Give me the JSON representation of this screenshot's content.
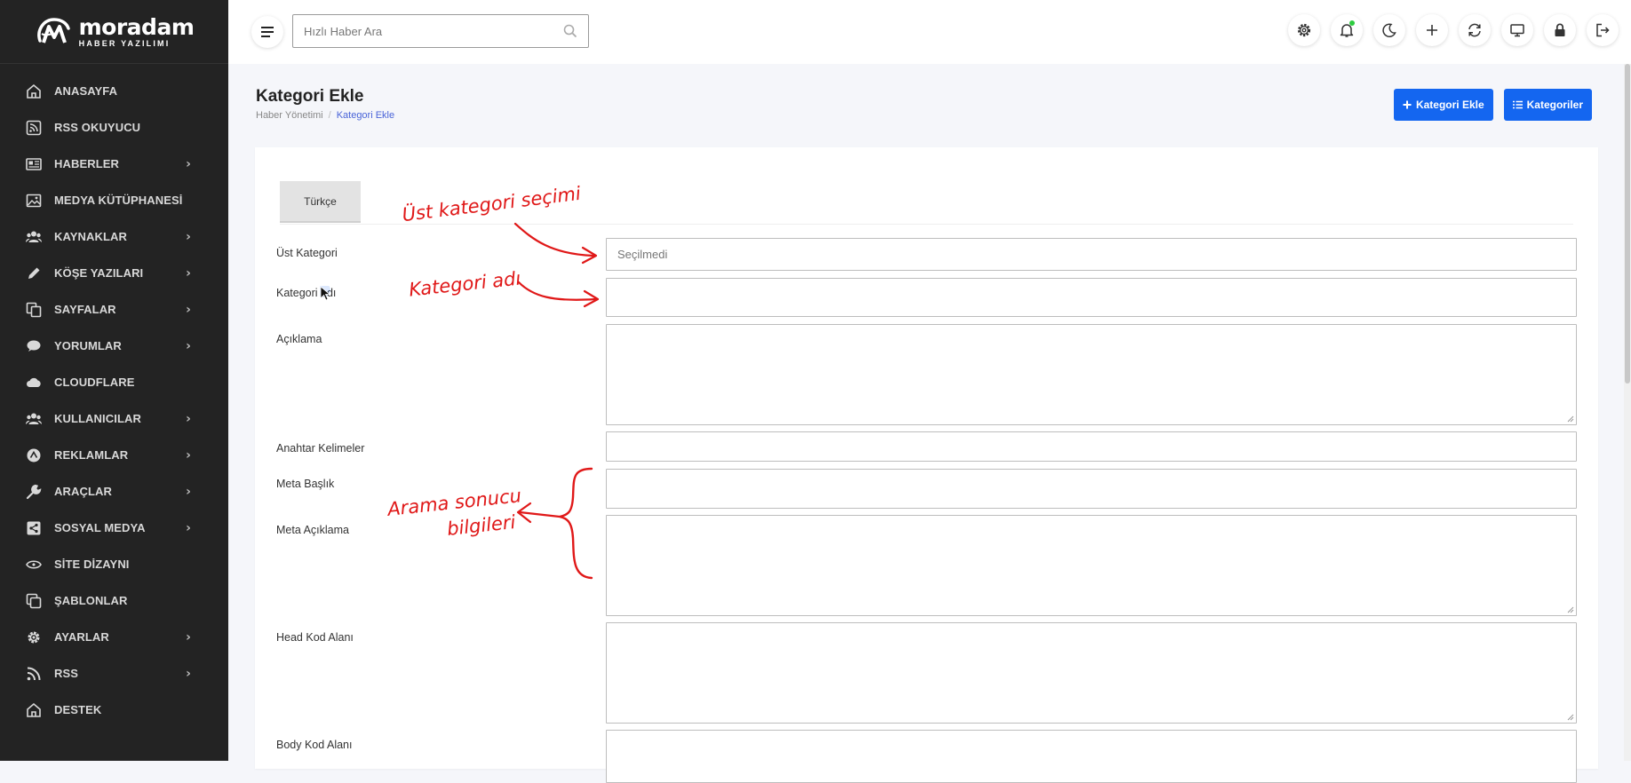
{
  "brand": {
    "name": "moradam",
    "tagline": "HABER YAZILIMI"
  },
  "sidebar": {
    "items": [
      {
        "label": "ANASAYFA",
        "icon": "home-icon",
        "has_children": false
      },
      {
        "label": "RSS OKUYUCU",
        "icon": "rss-box-icon",
        "has_children": false
      },
      {
        "label": "HABERLER",
        "icon": "newspaper-icon",
        "has_children": true
      },
      {
        "label": "MEDYA KÜTÜPHANESİ",
        "icon": "image-icon",
        "has_children": false
      },
      {
        "label": "KAYNAKLAR",
        "icon": "users-icon",
        "has_children": true
      },
      {
        "label": "KÖŞE YAZILARI",
        "icon": "pencil-icon",
        "has_children": true
      },
      {
        "label": "SAYFALAR",
        "icon": "pages-icon",
        "has_children": true
      },
      {
        "label": "YORUMLAR",
        "icon": "comment-icon",
        "has_children": true
      },
      {
        "label": "CLOUDFLARE",
        "icon": "cloud-icon",
        "has_children": false
      },
      {
        "label": "KULLANICILAR",
        "icon": "users-icon",
        "has_children": true
      },
      {
        "label": "REKLAMLAR",
        "icon": "ads-icon",
        "has_children": true
      },
      {
        "label": "ARAÇLAR",
        "icon": "wrench-icon",
        "has_children": true
      },
      {
        "label": "SOSYAL MEDYA",
        "icon": "share-icon",
        "has_children": true
      },
      {
        "label": "SİTE DİZAYNI",
        "icon": "eye-icon",
        "has_children": false
      },
      {
        "label": "ŞABLONLAR",
        "icon": "copy-icon",
        "has_children": false
      },
      {
        "label": "AYARLAR",
        "icon": "gear-icon",
        "has_children": true
      },
      {
        "label": "RSS",
        "icon": "rss-icon",
        "has_children": true
      },
      {
        "label": "DESTEK",
        "icon": "home-icon",
        "has_children": false
      }
    ],
    "chevron": "›"
  },
  "topbar": {
    "search_placeholder": "Hızlı Haber Ara",
    "tools": [
      "gear-icon",
      "bell-icon",
      "moon-icon",
      "plus-icon",
      "refresh-icon",
      "monitor-icon",
      "lock-icon",
      "logout-icon"
    ]
  },
  "page": {
    "title": "Kategori Ekle",
    "breadcrumb": {
      "parent": "Haber Yönetimi",
      "separator": "/",
      "current": "Kategori Ekle"
    },
    "buttons": {
      "add": "Kategori Ekle",
      "list": "Kategoriler"
    }
  },
  "form": {
    "tab": "Türkçe",
    "fields": {
      "parent_category": {
        "label": "Üst Kategori",
        "value": "Seçilmedi"
      },
      "category_name": {
        "label": "Kategori adı",
        "value": ""
      },
      "description": {
        "label": "Açıklama",
        "value": ""
      },
      "keywords": {
        "label": "Anahtar Kelimeler",
        "value": ""
      },
      "meta_title": {
        "label": "Meta Başlık",
        "value": ""
      },
      "meta_description": {
        "label": "Meta Açıklama",
        "value": ""
      },
      "head_code": {
        "label": "Head Kod Alanı",
        "value": ""
      },
      "body_code": {
        "label": "Body Kod Alanı",
        "value": ""
      }
    }
  },
  "annotations": {
    "parent_category": "Üst kategori seçimi",
    "category_name": "Kategori adı",
    "search_info_line1": "Arama sonucu",
    "search_info_line2": "bilgileri",
    "color": "#e01818"
  },
  "colors": {
    "sidebar": "#232323",
    "accent": "#1466f0",
    "breadcrumb_active": "#4a64d8"
  }
}
